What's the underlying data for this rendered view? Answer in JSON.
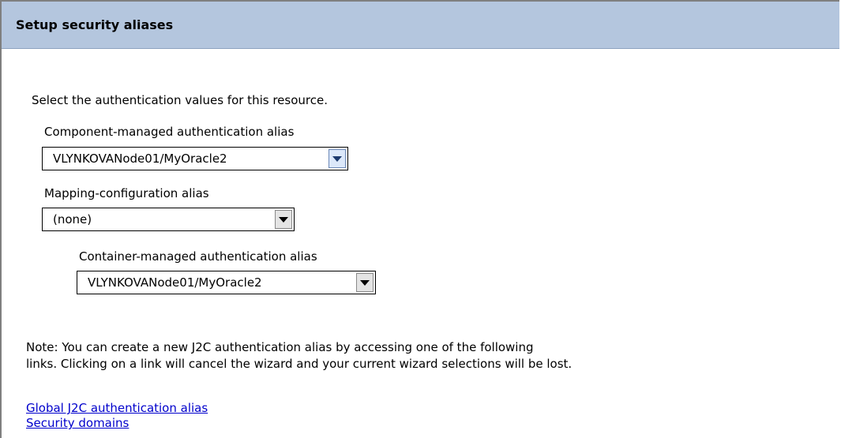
{
  "header": {
    "title": "Setup security aliases"
  },
  "main": {
    "intro": "Select the authentication values for this resource.",
    "component_alias": {
      "label": "Component-managed authentication alias",
      "value": "VLYNKOVANode01/MyOracle2"
    },
    "mapping_alias": {
      "label": "Mapping-configuration alias",
      "value": "(none)"
    },
    "container_alias": {
      "label": "Container-managed authentication alias",
      "value": "VLYNKOVANode01/MyOracle2"
    },
    "note_line1": "Note: You can create a new J2C authentication alias by accessing one of the following",
    "note_line2": "links. Clicking on a link will cancel the wizard and your current wizard selections will be lost.",
    "links": {
      "global_j2c": "Global J2C authentication alias",
      "security_domains": "Security domains"
    }
  },
  "colors": {
    "header_bg": "#b4c6de",
    "link": "#0000cc"
  },
  "icons": {
    "dropdown": "chevron-down-icon"
  }
}
